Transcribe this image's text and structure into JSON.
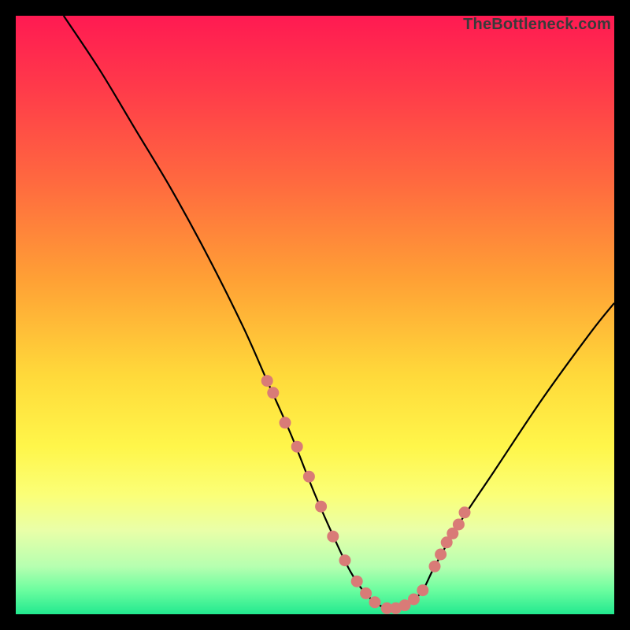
{
  "watermark": "TheBottleneck.com",
  "chart_data": {
    "type": "line",
    "title": "",
    "xlabel": "",
    "ylabel": "",
    "xlim": [
      0,
      100
    ],
    "ylim": [
      0,
      100
    ],
    "series": [
      {
        "name": "main-curve",
        "color": "#000000",
        "x": [
          8,
          14,
          20,
          26,
          32,
          38,
          42,
          46,
          50,
          54,
          56,
          58,
          60,
          62,
          64,
          66,
          68,
          70,
          74,
          80,
          88,
          96,
          100
        ],
        "y": [
          100,
          91,
          81,
          71,
          60,
          48,
          39,
          30,
          20,
          11,
          7,
          4,
          2,
          1,
          1,
          2,
          4,
          8,
          15,
          24,
          36,
          47,
          52
        ]
      },
      {
        "name": "highlight-dots",
        "color": "#d97b77",
        "x": [
          42,
          43,
          45,
          47,
          49,
          51,
          53,
          55,
          57,
          58.5,
          60,
          62,
          63.5,
          65,
          66.5,
          68,
          70,
          71,
          72,
          73,
          74,
          75
        ],
        "y": [
          39,
          37,
          32,
          28,
          23,
          18,
          13,
          9,
          5.5,
          3.5,
          2,
          1,
          1,
          1.5,
          2.5,
          4,
          8,
          10,
          12,
          13.5,
          15,
          17
        ]
      }
    ],
    "annotations": []
  }
}
